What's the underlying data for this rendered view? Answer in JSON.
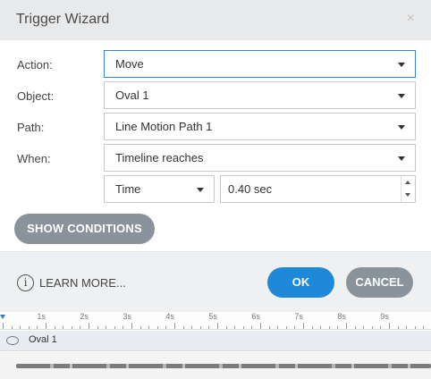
{
  "window": {
    "title": "Trigger Wizard",
    "close_glyph": "×"
  },
  "form": {
    "action_label": "Action:",
    "action_value": "Move",
    "object_label": "Object:",
    "object_value": "Oval 1",
    "path_label": "Path:",
    "path_value": "Line Motion Path 1",
    "when_label": "When:",
    "when_value": "Timeline reaches",
    "time_mode_value": "Time",
    "time_value": "0.40 sec"
  },
  "buttons": {
    "show_conditions": "SHOW CONDITIONS",
    "learn_more": "LEARN MORE...",
    "ok": "OK",
    "cancel": "CANCEL"
  },
  "timeline": {
    "ruler_labels": [
      "1s",
      "2s",
      "3s",
      "4s",
      "5s",
      "6s",
      "7s",
      "8s",
      "9s",
      "10"
    ],
    "track_name": "Oval 1"
  },
  "colors": {
    "accent": "#1e88d9",
    "secondary_button": "#8a939b",
    "focus_border": "#3a83c8"
  }
}
